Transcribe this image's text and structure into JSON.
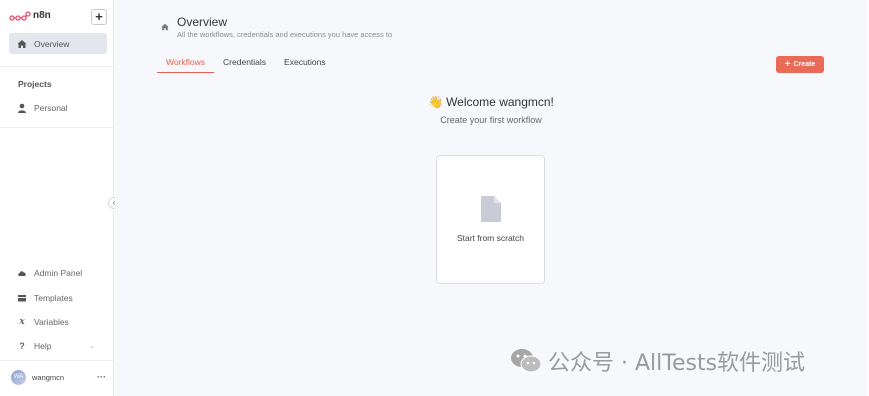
{
  "app": {
    "name": "n8n"
  },
  "sidebar": {
    "overview_label": "Overview",
    "projects_title": "Projects",
    "personal_label": "Personal",
    "admin_panel_label": "Admin Panel",
    "templates_label": "Templates",
    "variables_label": "Variables",
    "help_label": "Help",
    "user": {
      "initials": "WA",
      "name": "wangmcn"
    }
  },
  "header": {
    "title": "Overview",
    "subtitle": "All the workflows, credentials and executions you have access to"
  },
  "tabs": [
    {
      "label": "Workflows",
      "active": true
    },
    {
      "label": "Credentials",
      "active": false
    },
    {
      "label": "Executions",
      "active": false
    }
  ],
  "create_button": {
    "label": "Create"
  },
  "empty_state": {
    "emoji": "👋",
    "welcome": "Welcome wangmcn!",
    "prompt": "Create your first workflow",
    "card_label": "Start from scratch"
  },
  "watermark": {
    "text": "公众号 · AllTests软件测试"
  },
  "colors": {
    "accent": "#ea5f4f",
    "create_bg": "#ea6a58",
    "active_nav_bg": "#e4e6ee",
    "main_bg": "#f7f8fb"
  }
}
